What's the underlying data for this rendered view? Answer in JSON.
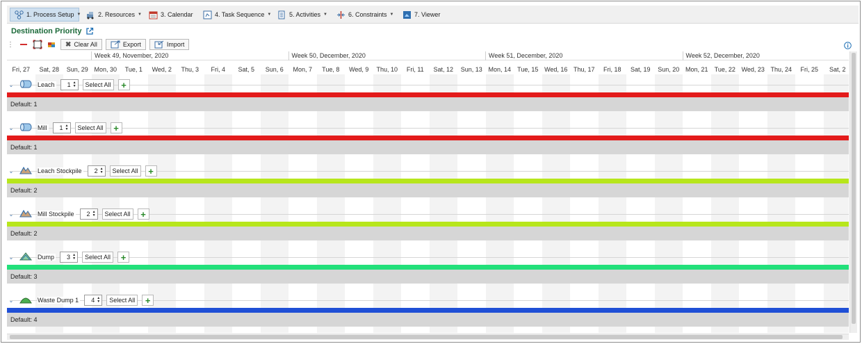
{
  "menu": [
    {
      "label": "1. Process Setup",
      "icon": "process-setup-icon",
      "dropdown": true
    },
    {
      "label": "2. Resources",
      "icon": "resources-icon",
      "dropdown": true
    },
    {
      "label": "3. Calendar",
      "icon": "calendar-icon",
      "dropdown": false
    },
    {
      "label": "4. Task Sequence",
      "icon": "task-sequence-icon",
      "dropdown": true
    },
    {
      "label": "5. Activities",
      "icon": "activities-icon",
      "dropdown": true
    },
    {
      "label": "6. Constraints",
      "icon": "constraints-icon",
      "dropdown": true
    },
    {
      "label": "7. Viewer",
      "icon": "viewer-icon",
      "dropdown": false
    }
  ],
  "page": {
    "title": "Destination Priority"
  },
  "toolbar": {
    "clear_all": "Clear All",
    "export": "Export",
    "import": "Import"
  },
  "weeks": [
    "Week 49, November, 2020",
    "Week 50, December, 2020",
    "Week 51, December, 2020",
    "Week 52, December, 2020"
  ],
  "days": [
    "Fri, 27",
    "Sat, 28",
    "Sun, 29",
    "Mon, 30",
    "Tue, 1",
    "Wed, 2",
    "Thu, 3",
    "Fri, 4",
    "Sat, 5",
    "Sun, 6",
    "Mon, 7",
    "Tue, 8",
    "Wed, 9",
    "Thu, 10",
    "Fri, 11",
    "Sat, 12",
    "Sun, 13",
    "Mon, 14",
    "Tue, 15",
    "Wed, 16",
    "Thu, 17",
    "Fri, 18",
    "Sat, 19",
    "Sun, 20",
    "Mon, 21",
    "Tue, 22",
    "Wed, 23",
    "Thu, 24",
    "Fri, 25",
    "Sat, 2"
  ],
  "destinations": [
    {
      "name": "Leach",
      "priority": "1",
      "select_all": "Select All",
      "default": "Default: 1",
      "bar_color": "#e31b1b",
      "icon": "leach-icon"
    },
    {
      "name": "Mill",
      "priority": "1",
      "select_all": "Select All",
      "default": "Default: 1",
      "bar_color": "#e31b1b",
      "icon": "mill-icon"
    },
    {
      "name": "Leach Stockpile",
      "priority": "2",
      "select_all": "Select All",
      "default": "Default: 2",
      "bar_color": "#b7e61c",
      "icon": "stockpile-icon"
    },
    {
      "name": "Mill Stockpile",
      "priority": "2",
      "select_all": "Select All",
      "default": "Default: 2",
      "bar_color": "#b7e61c",
      "icon": "stockpile-icon"
    },
    {
      "name": "Dump",
      "priority": "3",
      "select_all": "Select All",
      "default": "Default: 3",
      "bar_color": "#22e07a",
      "icon": "dump-icon"
    },
    {
      "name": "Waste Dump 1",
      "priority": "4",
      "select_all": "Select All",
      "default": "Default: 4",
      "bar_color": "#1f4fd6",
      "icon": "waste-dump-icon"
    }
  ]
}
